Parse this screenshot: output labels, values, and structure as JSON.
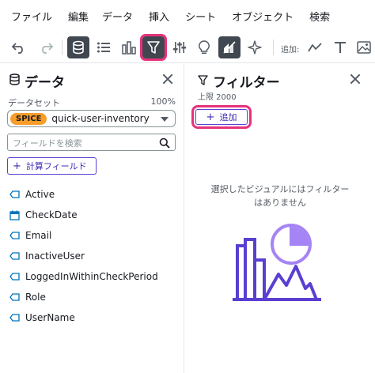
{
  "menu": [
    "ファイル",
    "編集",
    "データ",
    "挿入",
    "シート",
    "オブジェクト",
    "検索"
  ],
  "toolbar": {
    "add_label": "追加:",
    "icons": [
      "undo-icon",
      "redo-icon",
      "data-icon",
      "list-icon",
      "bar-chart-icon",
      "filter-icon",
      "sliders-icon",
      "lightbulb-icon",
      "chart-format-icon",
      "sparkle-icon",
      "line-icon",
      "text-icon",
      "image-icon"
    ],
    "highlight_color": "#e8317a"
  },
  "data_panel": {
    "title": "データ",
    "dataset_label": "データセット",
    "dataset_usage": "100%",
    "spice_badge": "SPICE",
    "dataset_name": "quick-user-inventory",
    "search_placeholder": "フィールドを検索",
    "calc_field_button": "計算フィールド",
    "fields": [
      {
        "name": "Active",
        "icon": "string-field-icon"
      },
      {
        "name": "CheckDate",
        "icon": "date-field-icon"
      },
      {
        "name": "Email",
        "icon": "string-field-icon"
      },
      {
        "name": "InactiveUser",
        "icon": "string-field-icon"
      },
      {
        "name": "LoggedInWithinCheckPeriod",
        "icon": "string-field-icon"
      },
      {
        "name": "Role",
        "icon": "string-field-icon"
      },
      {
        "name": "UserName",
        "icon": "string-field-icon"
      }
    ]
  },
  "filter_panel": {
    "title": "フィルター",
    "limit_text": "上限 2000",
    "add_button": "追加",
    "empty_message": "選択したビジュアルにはフィルターはありません"
  },
  "colors": {
    "accent": "#5a3fd1",
    "spice": "#f89d2a",
    "active_tool": "#414750"
  }
}
